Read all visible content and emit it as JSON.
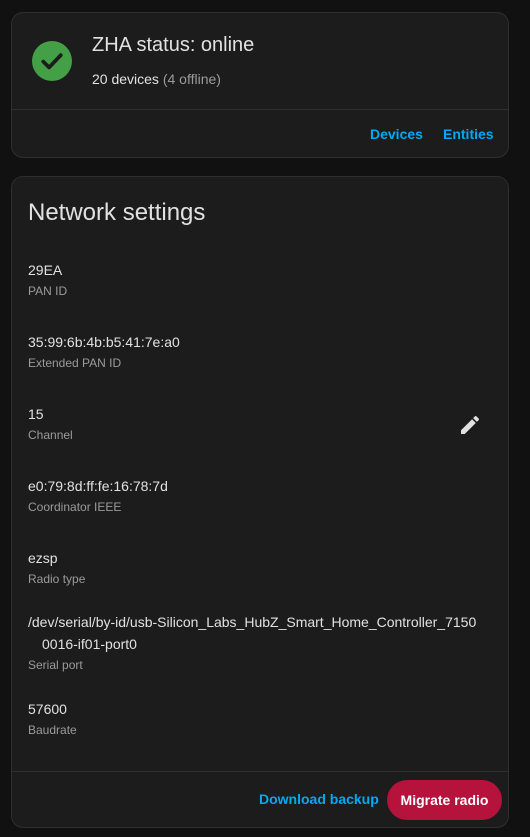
{
  "status_card": {
    "icon": "check-circle-icon",
    "title": "ZHA status: online",
    "devices_text": "20 devices",
    "offline_text": "(4 offline)",
    "devices_button": "Devices",
    "entities_button": "Entities"
  },
  "network_settings": {
    "title": "Network settings",
    "items": [
      {
        "value": "29EA",
        "label": "PAN ID"
      },
      {
        "value": "35:99:6b:4b:b5:41:7e:a0",
        "label": "Extended PAN ID"
      },
      {
        "value": "15",
        "label": "Channel"
      },
      {
        "value": "e0:79:8d:ff:fe:16:78:7d",
        "label": "Coordinator IEEE"
      },
      {
        "value": "ezsp",
        "label": "Radio type"
      },
      {
        "value_line1": "/dev/serial/by-id/usb-Silicon_Labs_HubZ_Smart_Home_Controller_7150",
        "value_line2": "0016-if01-port0",
        "label": "Serial port"
      },
      {
        "value": "57600",
        "label": "Baudrate"
      }
    ],
    "edit_icon": "pencil-icon",
    "download_backup_button": "Download backup",
    "migrate_radio_button": "Migrate radio"
  },
  "colors": {
    "background": "#111111",
    "card": "#1c1c1c",
    "success": "#43a047",
    "accent_link": "#03a9f4",
    "migrate_button": "#b5123c"
  }
}
